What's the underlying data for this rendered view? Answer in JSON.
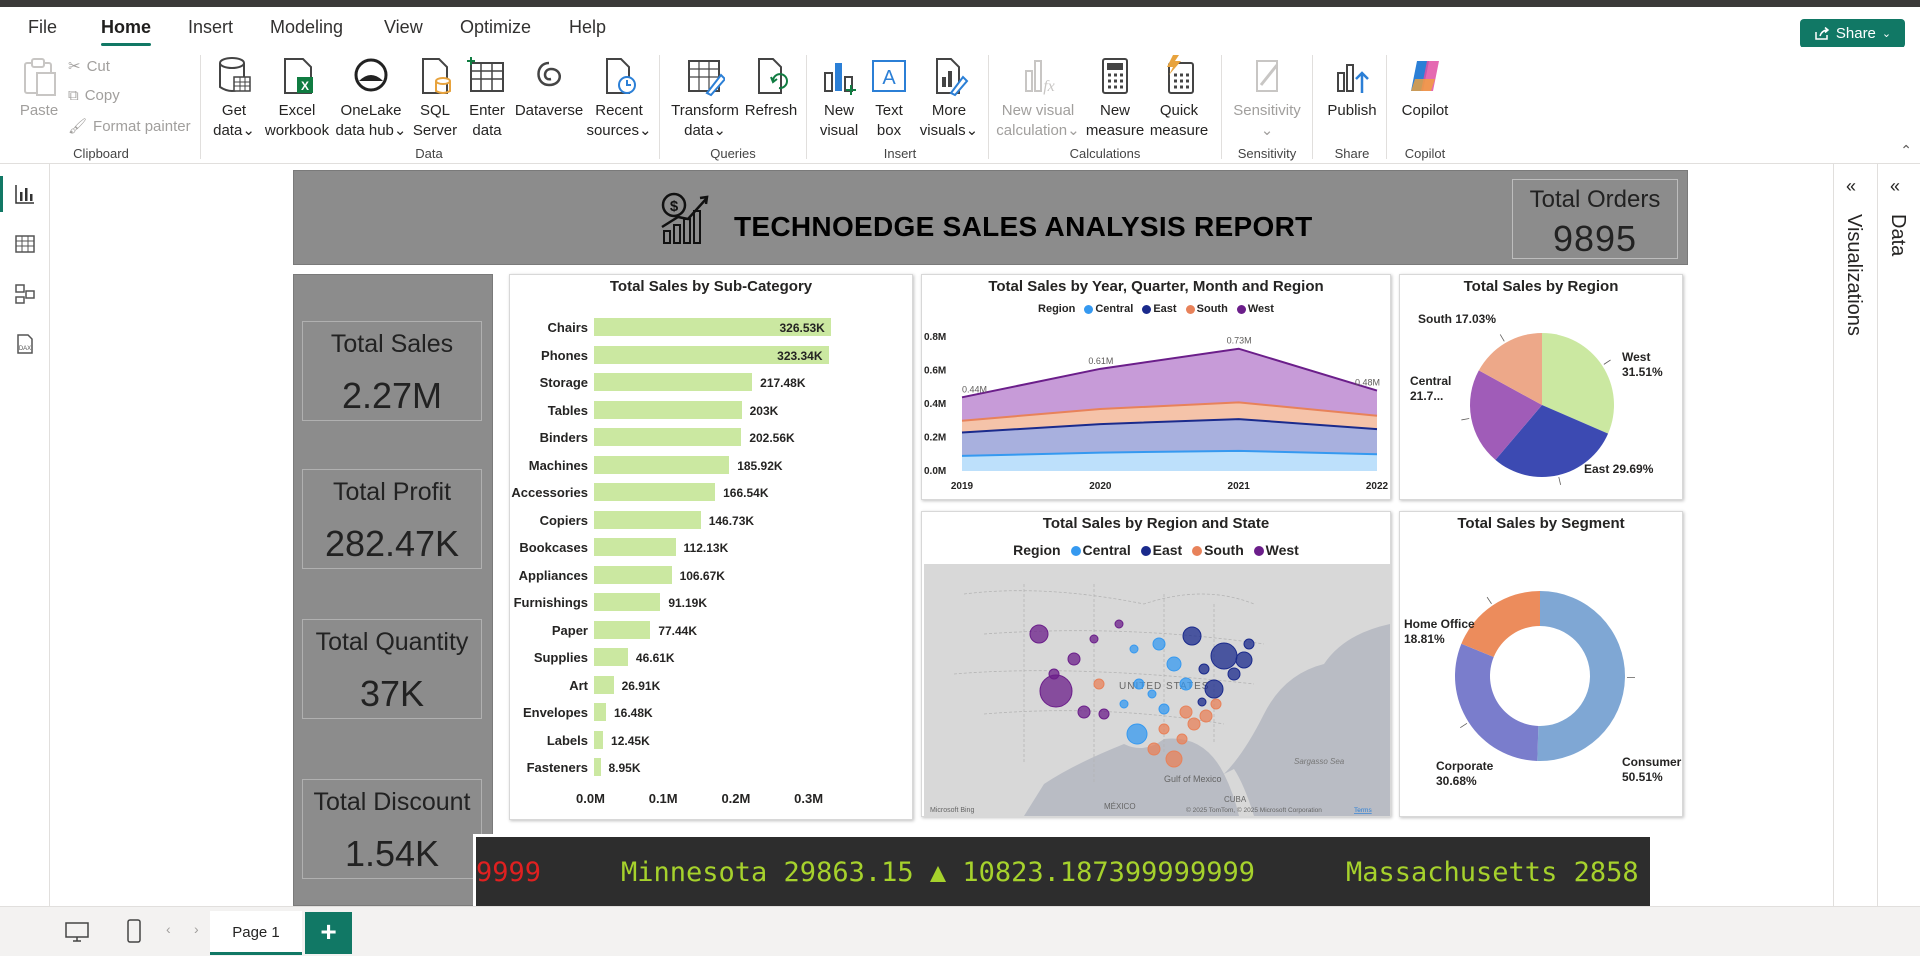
{
  "ribbon_tabs": [
    "File",
    "Home",
    "Insert",
    "Modeling",
    "View",
    "Optimize",
    "Help"
  ],
  "share_label": "Share",
  "ribbon": {
    "clipboard": {
      "paste": "Paste",
      "cut": "Cut",
      "copy": "Copy",
      "format_painter": "Format painter",
      "group": "Clipboard"
    },
    "data": {
      "get_data": [
        "Get",
        "data"
      ],
      "excel": [
        "Excel",
        "workbook"
      ],
      "onelake": [
        "OneLake",
        "data hub"
      ],
      "sql": [
        "SQL",
        "Server"
      ],
      "enter": [
        "Enter",
        "data"
      ],
      "dataverse": [
        "Dataverse"
      ],
      "recent": [
        "Recent",
        "sources"
      ],
      "group": "Data"
    },
    "queries": {
      "transform": [
        "Transform",
        "data"
      ],
      "refresh": [
        "Refresh"
      ],
      "group": "Queries"
    },
    "insert": {
      "new_visual": [
        "New",
        "visual"
      ],
      "text_box": [
        "Text",
        "box"
      ],
      "more_visuals": [
        "More",
        "visuals"
      ],
      "group": "Insert"
    },
    "calculations": {
      "new_visual_calc": [
        "New visual",
        "calculation"
      ],
      "new_measure": [
        "New",
        "measure"
      ],
      "quick_measure": [
        "Quick",
        "measure"
      ],
      "group": "Calculations"
    },
    "sensitivity": {
      "label": "Sensitivity",
      "group": "Sensitivity"
    },
    "share": {
      "publish": "Publish",
      "group": "Share"
    },
    "copilot": {
      "label": "Copilot",
      "group": "Copilot"
    }
  },
  "report": {
    "title": "TECHNOEDGE SALES ANALYSIS REPORT",
    "total_orders": {
      "label": "Total Orders",
      "value": "9895"
    },
    "kpis": [
      {
        "label": "Total Sales",
        "value": "2.27M"
      },
      {
        "label": "Total Profit",
        "value": "282.47K"
      },
      {
        "label": "Total Quantity",
        "value": "37K"
      },
      {
        "label": "Total Discount",
        "value": "1.54K"
      }
    ],
    "ticker": {
      "left_value": "9999",
      "text": "Minnesota 29863.15 ▲ 10823.187399999999",
      "next": "Massachusetts 2858"
    }
  },
  "panes": {
    "visualizations": "Visualizations",
    "data": "Data"
  },
  "page_tab": "Page 1",
  "colors": {
    "accent": "#117865",
    "bar": "#cbe8a1",
    "central": "#3599f0",
    "east": "#1a2a8c",
    "south": "#e8825a",
    "west": "#6b1e8a"
  },
  "chart_data": [
    {
      "type": "bar",
      "title": "Total Sales by Sub-Category",
      "categories": [
        "Chairs",
        "Phones",
        "Storage",
        "Tables",
        "Binders",
        "Machines",
        "Accessories",
        "Copiers",
        "Bookcases",
        "Appliances",
        "Furnishings",
        "Paper",
        "Supplies",
        "Art",
        "Envelopes",
        "Labels",
        "Fasteners"
      ],
      "values": [
        326530,
        323340,
        217480,
        203000,
        202560,
        185920,
        166540,
        146730,
        112130,
        106670,
        91190,
        77440,
        46610,
        26910,
        16480,
        12450,
        8950
      ],
      "value_labels": [
        "326.53K",
        "323.34K",
        "217.48K",
        "203K",
        "202.56K",
        "185.92K",
        "166.54K",
        "146.73K",
        "112.13K",
        "106.67K",
        "91.19K",
        "77.44K",
        "46.61K",
        "26.91K",
        "16.48K",
        "12.45K",
        "8.95K"
      ],
      "xticks": [
        "0.0M",
        "0.1M",
        "0.2M",
        "0.3M"
      ],
      "xlim": [
        0,
        0.33
      ]
    },
    {
      "type": "area",
      "title": "Total Sales by Year, Quarter, Month and Region",
      "legend_title": "Region",
      "x": [
        "2019",
        "2020",
        "2021",
        "2022"
      ],
      "series": [
        {
          "name": "Central",
          "values": [
            0.09,
            0.11,
            0.12,
            0.1
          ]
        },
        {
          "name": "East",
          "values": [
            0.14,
            0.17,
            0.19,
            0.15
          ]
        },
        {
          "name": "South",
          "values": [
            0.07,
            0.09,
            0.1,
            0.08
          ]
        },
        {
          "name": "West",
          "values": [
            0.14,
            0.24,
            0.32,
            0.15
          ]
        }
      ],
      "totals": [
        0.44,
        0.61,
        0.73,
        0.48
      ],
      "total_labels": [
        "0.44M",
        "0.61M",
        "0.73M",
        "0.48M"
      ],
      "yticks": [
        "0.0M",
        "0.2M",
        "0.4M",
        "0.6M",
        "0.8M"
      ],
      "ylim": [
        0,
        0.8
      ]
    },
    {
      "type": "pie",
      "title": "Total Sales by Region",
      "slices": [
        {
          "name": "West",
          "value": 31.51,
          "label": "West\n31.51%"
        },
        {
          "name": "East",
          "value": 29.69,
          "label": "East 29.69%"
        },
        {
          "name": "Central",
          "value": 21.77,
          "label": "Central\n21.7..."
        },
        {
          "name": "South",
          "value": 17.03,
          "label": "South 17.03%"
        }
      ]
    },
    {
      "type": "pie",
      "title": "Total Sales by Segment",
      "donut": true,
      "slices": [
        {
          "name": "Consumer",
          "value": 50.51,
          "label": "Consumer\n50.51%"
        },
        {
          "name": "Corporate",
          "value": 30.68,
          "label": "Corporate\n30.68%"
        },
        {
          "name": "Home Office",
          "value": 18.81,
          "label": "Home Office\n18.81%"
        }
      ]
    }
  ],
  "map": {
    "title": "Total Sales by Region and State",
    "legend_title": "Region",
    "legend": [
      "Central",
      "East",
      "South",
      "West"
    ],
    "labels": {
      "country": "UNITED STATES",
      "gulf": "Gulf of Mexico",
      "mexico": "MÉXICO",
      "cuba": "CUBA",
      "sargasso": "Sargasso Sea",
      "bing": "Microsoft Bing",
      "copyright": "© 2025 TomTom, © 2025 Microsoft Corporation",
      "terms": "Terms"
    }
  }
}
